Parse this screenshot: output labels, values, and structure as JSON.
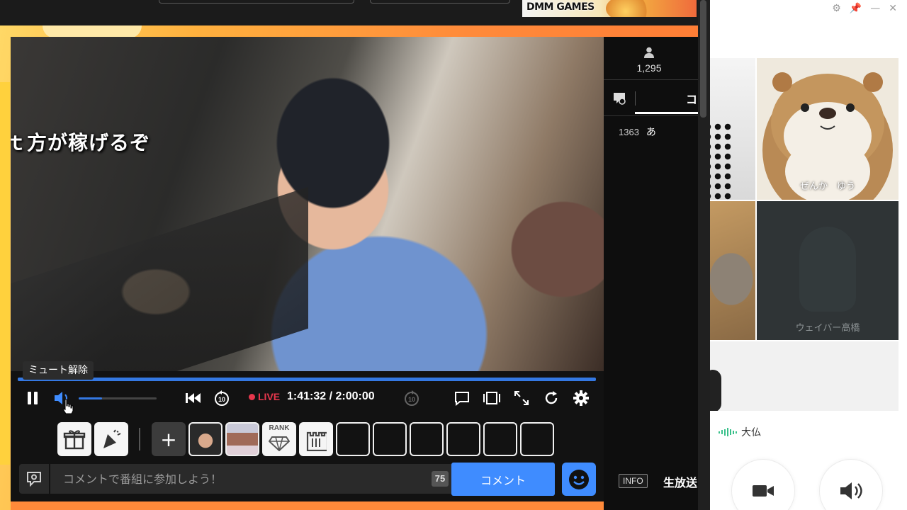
{
  "banner": {
    "ad_text": "DMM GAMES"
  },
  "video": {
    "caption": "ｔ方が稼げるぞ"
  },
  "player": {
    "tooltip": "ミュート解除",
    "live_label": "LIVE",
    "time": "1:41:32 / 2:00:00",
    "progress_fraction": 0.99,
    "volume_fraction": 0.3,
    "icons": [
      "pause-icon",
      "volume-icon",
      "skip-back-icon",
      "replay-10-icon",
      "forward-10-icon",
      "comment-toggle-icon",
      "theater-icon",
      "fullscreen-icon",
      "reload-icon",
      "settings-icon"
    ]
  },
  "items": {
    "add_label": "+",
    "rank_label": "RANK",
    "slots": [
      "gift",
      "party",
      "add",
      "thumb-a",
      "thumb-b",
      "rank",
      "castle",
      "empty",
      "empty",
      "empty",
      "empty",
      "empty",
      "empty"
    ]
  },
  "comment_bar": {
    "placeholder": "コメントで番組に参加しよう！",
    "char_count": "75",
    "submit_label": "コメント"
  },
  "side": {
    "viewer_count": "1,295",
    "tab_label": "コ",
    "comments": [
      {
        "number": "1363",
        "text": "あ"
      }
    ],
    "info_badge": "INFO",
    "info_text": "生放送"
  },
  "call": {
    "window_icons": [
      "gear-icon",
      "pin-icon",
      "minimize-icon",
      "close-icon"
    ],
    "participants": [
      {
        "name": "ぜんか　ゆう"
      },
      {
        "name": "ウェイバー高橋"
      }
    ],
    "active_speaker": "大仏"
  },
  "colors": {
    "accent_blue": "#3f8cff",
    "progress_blue": "#3478e2",
    "live_red": "#e6374c",
    "banner_orange": "#ff8a3a"
  }
}
